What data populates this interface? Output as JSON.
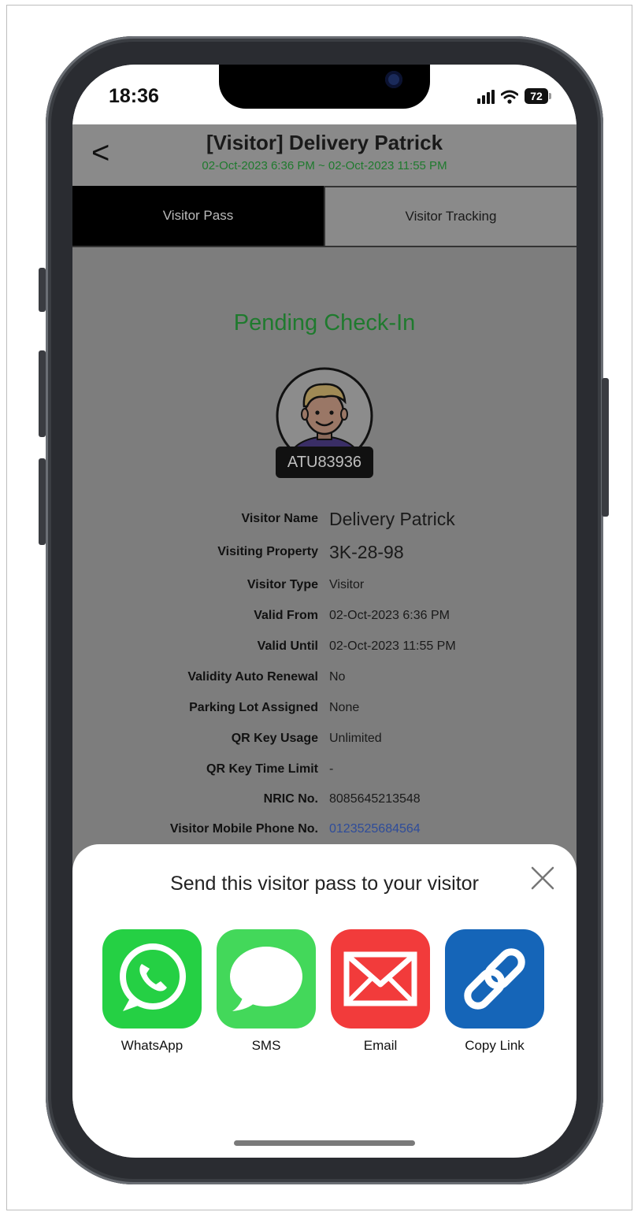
{
  "status_bar": {
    "time": "18:36",
    "battery": "72"
  },
  "header": {
    "back_glyph": "<",
    "title": "[Visitor] Delivery Patrick",
    "period": "02-Oct-2023 6:36 PM ~ 02-Oct-2023 11:55 PM"
  },
  "tabs": [
    {
      "label": "Visitor Pass",
      "active": true
    },
    {
      "label": "Visitor Tracking",
      "active": false
    }
  ],
  "pass": {
    "status": "Pending Check-In",
    "code": "ATU83936",
    "details": [
      {
        "label": "Visitor Name",
        "value": "Delivery Patrick"
      },
      {
        "label": "Visiting Property",
        "value": "3K-28-98"
      },
      {
        "label": "Visitor Type",
        "value": "Visitor"
      },
      {
        "label": "Valid From",
        "value": "02-Oct-2023 6:36 PM"
      },
      {
        "label": "Valid Until",
        "value": "02-Oct-2023 11:55 PM"
      },
      {
        "label": "Validity Auto Renewal",
        "value": "No"
      },
      {
        "label": "Parking Lot Assigned",
        "value": "None"
      },
      {
        "label": "QR Key Usage",
        "value": "Unlimited"
      },
      {
        "label": "QR Key Time Limit",
        "value": "-"
      },
      {
        "label": "NRIC No.",
        "value": "8085645213548"
      },
      {
        "label": "Visitor Mobile Phone No.",
        "value": "0123525684564"
      }
    ]
  },
  "share_sheet": {
    "title": "Send this visitor pass to your visitor",
    "options": [
      {
        "label": "WhatsApp",
        "icon": "whatsapp-icon",
        "color": "#25d044"
      },
      {
        "label": "SMS",
        "icon": "message-bubble-icon",
        "color": "#43d85a"
      },
      {
        "label": "Email",
        "icon": "envelope-icon",
        "color": "#f23b3b"
      },
      {
        "label": "Copy Link",
        "icon": "link-icon",
        "color": "#1565b8"
      }
    ]
  },
  "colors": {
    "status_green": "#1f7a2e",
    "overlay_gray": "#7d7d7d",
    "link_blue": "#2e4c9a"
  }
}
